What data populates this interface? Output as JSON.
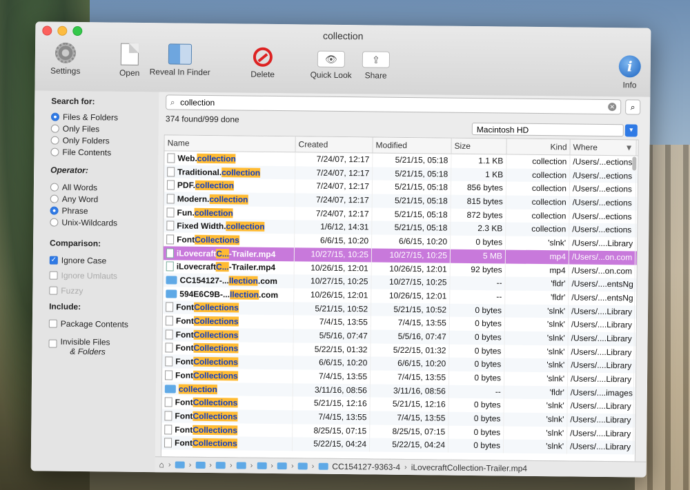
{
  "window": {
    "title": "collection"
  },
  "toolbar": {
    "settings": "Settings",
    "open": "Open",
    "reveal": "Reveal In Finder",
    "delete": "Delete",
    "quicklook": "Quick Look",
    "share": "Share",
    "info": "Info"
  },
  "sidebar": {
    "search_for": "Search for:",
    "files_folders": "Files & Folders",
    "only_files": "Only Files",
    "only_folders": "Only Folders",
    "file_contents": "File Contents",
    "operator": "Operator:",
    "all_words": "All Words",
    "any_word": "Any Word",
    "phrase": "Phrase",
    "unix_wildcards": "Unix-Wildcards",
    "comparison": "Comparison:",
    "ignore_case": "Ignore Case",
    "ignore_umlauts": "Ignore Umlauts",
    "fuzzy": "Fuzzy",
    "include": "Include:",
    "package_contents": "Package Contents",
    "invisible_files_1": "Invisible Files",
    "invisible_files_2": "& Folders"
  },
  "search": {
    "query": "collection",
    "status": "374 found/999 done",
    "volume": "Macintosh HD"
  },
  "columns": {
    "name": "Name",
    "created": "Created",
    "modified": "Modified",
    "size": "Size",
    "kind": "Kind",
    "where": "Where"
  },
  "rows": [
    {
      "icon": "doc",
      "pre": "Web.",
      "hl": "collection",
      "post": "",
      "created": "7/24/07, 12:17",
      "modified": "5/21/15, 05:18",
      "size": "1.1 KB",
      "kind": "collection",
      "where": "/Users/...ections"
    },
    {
      "icon": "doc",
      "pre": "Traditional.",
      "hl": "collection",
      "post": "",
      "created": "7/24/07, 12:17",
      "modified": "5/21/15, 05:18",
      "size": "1 KB",
      "kind": "collection",
      "where": "/Users/...ections"
    },
    {
      "icon": "doc",
      "pre": "PDF.",
      "hl": "collection",
      "post": "",
      "created": "7/24/07, 12:17",
      "modified": "5/21/15, 05:18",
      "size": "856 bytes",
      "kind": "collection",
      "where": "/Users/...ections"
    },
    {
      "icon": "doc",
      "pre": "Modern.",
      "hl": "collection",
      "post": "",
      "created": "7/24/07, 12:17",
      "modified": "5/21/15, 05:18",
      "size": "815 bytes",
      "kind": "collection",
      "where": "/Users/...ections"
    },
    {
      "icon": "doc",
      "pre": "Fun.",
      "hl": "collection",
      "post": "",
      "created": "7/24/07, 12:17",
      "modified": "5/21/15, 05:18",
      "size": "872 bytes",
      "kind": "collection",
      "where": "/Users/...ections"
    },
    {
      "icon": "doc",
      "pre": "Fixed Width.",
      "hl": "collection",
      "post": "",
      "created": "1/6/12, 14:31",
      "modified": "5/21/15, 05:18",
      "size": "2.3 KB",
      "kind": "collection",
      "where": "/Users/...ections"
    },
    {
      "icon": "doc",
      "pre": "Font",
      "hl": "Collections",
      "post": "",
      "created": "6/6/15, 10:20",
      "modified": "6/6/15, 10:20",
      "size": "0 bytes",
      "kind": "'slnk'",
      "where": "/Users/....Library"
    },
    {
      "icon": "video",
      "pre": "iLovecraft",
      "hl": "C...",
      "post": "-Trailer.mp4",
      "created": "10/27/15, 10:25",
      "modified": "10/27/15, 10:25",
      "size": "5 MB",
      "kind": "mp4",
      "where": "/Users/...on.com",
      "selected": true
    },
    {
      "icon": "video",
      "pre": "iLovecraft",
      "hl": "C...",
      "post": "-Trailer.mp4",
      "created": "10/26/15, 12:01",
      "modified": "10/26/15, 12:01",
      "size": "92 bytes",
      "kind": "mp4",
      "where": "/Users/...on.com"
    },
    {
      "icon": "folder",
      "pre": "CC154127-...",
      "hl": "llection",
      "post": ".com",
      "created": "10/27/15, 10:25",
      "modified": "10/27/15, 10:25",
      "size": "--",
      "kind": "'fldr'",
      "where": "/Users/....entsNg"
    },
    {
      "icon": "folder",
      "pre": "594E6C9B-...",
      "hl": "llection",
      "post": ".com",
      "created": "10/26/15, 12:01",
      "modified": "10/26/15, 12:01",
      "size": "--",
      "kind": "'fldr'",
      "where": "/Users/....entsNg"
    },
    {
      "icon": "doc",
      "pre": "Font",
      "hl": "Collections",
      "post": "",
      "created": "5/21/15, 10:52",
      "modified": "5/21/15, 10:52",
      "size": "0 bytes",
      "kind": "'slnk'",
      "where": "/Users/....Library"
    },
    {
      "icon": "doc",
      "pre": "Font",
      "hl": "Collections",
      "post": "",
      "created": "7/4/15, 13:55",
      "modified": "7/4/15, 13:55",
      "size": "0 bytes",
      "kind": "'slnk'",
      "where": "/Users/....Library"
    },
    {
      "icon": "doc",
      "pre": "Font",
      "hl": "Collections",
      "post": "",
      "created": "5/5/16, 07:47",
      "modified": "5/5/16, 07:47",
      "size": "0 bytes",
      "kind": "'slnk'",
      "where": "/Users/....Library"
    },
    {
      "icon": "doc",
      "pre": "Font",
      "hl": "Collections",
      "post": "",
      "created": "5/22/15, 01:32",
      "modified": "5/22/15, 01:32",
      "size": "0 bytes",
      "kind": "'slnk'",
      "where": "/Users/....Library"
    },
    {
      "icon": "doc",
      "pre": "Font",
      "hl": "Collections",
      "post": "",
      "created": "6/6/15, 10:20",
      "modified": "6/6/15, 10:20",
      "size": "0 bytes",
      "kind": "'slnk'",
      "where": "/Users/....Library"
    },
    {
      "icon": "doc",
      "pre": "Font",
      "hl": "Collections",
      "post": "",
      "created": "7/4/15, 13:55",
      "modified": "7/4/15, 13:55",
      "size": "0 bytes",
      "kind": "'slnk'",
      "where": "/Users/....Library"
    },
    {
      "icon": "folder",
      "pre": "",
      "hl": "collection",
      "post": "",
      "created": "3/11/16, 08:56",
      "modified": "3/11/16, 08:56",
      "size": "--",
      "kind": "'fldr'",
      "where": "/Users/....images"
    },
    {
      "icon": "doc",
      "pre": "Font",
      "hl": "Collections",
      "post": "",
      "created": "5/21/15, 12:16",
      "modified": "5/21/15, 12:16",
      "size": "0 bytes",
      "kind": "'slnk'",
      "where": "/Users/....Library"
    },
    {
      "icon": "doc",
      "pre": "Font",
      "hl": "Collections",
      "post": "",
      "created": "7/4/15, 13:55",
      "modified": "7/4/15, 13:55",
      "size": "0 bytes",
      "kind": "'slnk'",
      "where": "/Users/....Library"
    },
    {
      "icon": "doc",
      "pre": "Font",
      "hl": "Collections",
      "post": "",
      "created": "8/25/15, 07:15",
      "modified": "8/25/15, 07:15",
      "size": "0 bytes",
      "kind": "'slnk'",
      "where": "/Users/....Library"
    },
    {
      "icon": "doc",
      "pre": "Font",
      "hl": "Collections",
      "post": "",
      "created": "5/22/15, 04:24",
      "modified": "5/22/15, 04:24",
      "size": "0 bytes",
      "kind": "'slnk'",
      "where": "/Users/....Library"
    }
  ],
  "pathbar": {
    "folder": "CC154127-9363-4",
    "file_pre": "iLovecraft",
    "file_post": "Collection-Trailer.mp4"
  }
}
